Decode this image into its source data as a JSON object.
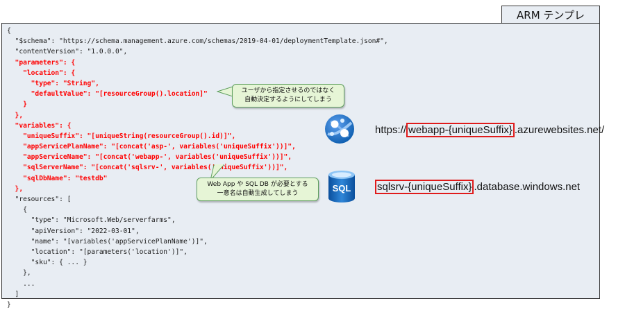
{
  "tab_label": "ARM テンプレ",
  "code_lines": [
    {
      "text": "{",
      "highlight": false
    },
    {
      "text": "  \"$schema\": \"https://schema.management.azure.com/schemas/2019-04-01/deploymentTemplate.json#\",",
      "highlight": false
    },
    {
      "text": "  \"contentVersion\": \"1.0.0.0\",",
      "highlight": false
    },
    {
      "text": "  \"parameters\": {",
      "highlight": true
    },
    {
      "text": "    \"location\": {",
      "highlight": true
    },
    {
      "text": "      \"type\": \"String\",",
      "highlight": true
    },
    {
      "text": "      \"defaultValue\": \"[resourceGroup().location]\"",
      "highlight": true
    },
    {
      "text": "    }",
      "highlight": true
    },
    {
      "text": "  },",
      "highlight": true
    },
    {
      "text": "  \"variables\": {",
      "highlight": true
    },
    {
      "text": "    \"uniqueSuffix\": \"[uniqueString(resourceGroup().id)]\",",
      "highlight": true
    },
    {
      "text": "    \"appServicePlanName\": \"[concat('asp-', variables('uniqueSuffix'))]\",",
      "highlight": true
    },
    {
      "text": "    \"appServiceName\": \"[concat('webapp-', variables('uniqueSuffix'))]\",",
      "highlight": true
    },
    {
      "text": "    \"sqlServerName\": \"[concat('sqlsrv-', variables('uniqueSuffix'))]\",",
      "highlight": true
    },
    {
      "text": "    \"sqlDbName\": \"testdb\"",
      "highlight": true
    },
    {
      "text": "  },",
      "highlight": true
    },
    {
      "text": "  \"resources\": [",
      "highlight": false
    },
    {
      "text": "    {",
      "highlight": false
    },
    {
      "text": "      \"type\": \"Microsoft.Web/serverfarms\",",
      "highlight": false
    },
    {
      "text": "      \"apiVersion\": \"2022-03-01\",",
      "highlight": false
    },
    {
      "text": "      \"name\": \"[variables('appServicePlanName')]\",",
      "highlight": false
    },
    {
      "text": "      \"location\": \"[parameters('location')]\",",
      "highlight": false
    },
    {
      "text": "      \"sku\": { ... }",
      "highlight": false
    },
    {
      "text": "    },",
      "highlight": false
    },
    {
      "text": "    ...",
      "highlight": false
    },
    {
      "text": "  ]",
      "highlight": false
    },
    {
      "text": "}",
      "highlight": false
    }
  ],
  "callout_location": {
    "line1": "ユーザから指定させるのではなく",
    "line2": "自動決定するようにしてしまう"
  },
  "callout_names": {
    "line1": "Web App や SQL DB が必要とする",
    "line2": "一意名は自動生成してしまう"
  },
  "webapp_url": {
    "prefix": "https://",
    "highlight": "webapp-{uniqueSuffix}",
    "suffix": ".azurewebsites.net/"
  },
  "sql_url": {
    "highlight": "sqlsrv-{uniqueSuffix}",
    "suffix": ".database.windows.net"
  },
  "sql_icon_label": "SQL",
  "colors": {
    "panel_bg": "#e8edf3",
    "highlight_text": "#ff0000",
    "callout_bg": "#e6f5d6",
    "callout_border": "#5f9f5f",
    "azure_blue": "#0078d4",
    "box_red": "#e01b1b"
  }
}
